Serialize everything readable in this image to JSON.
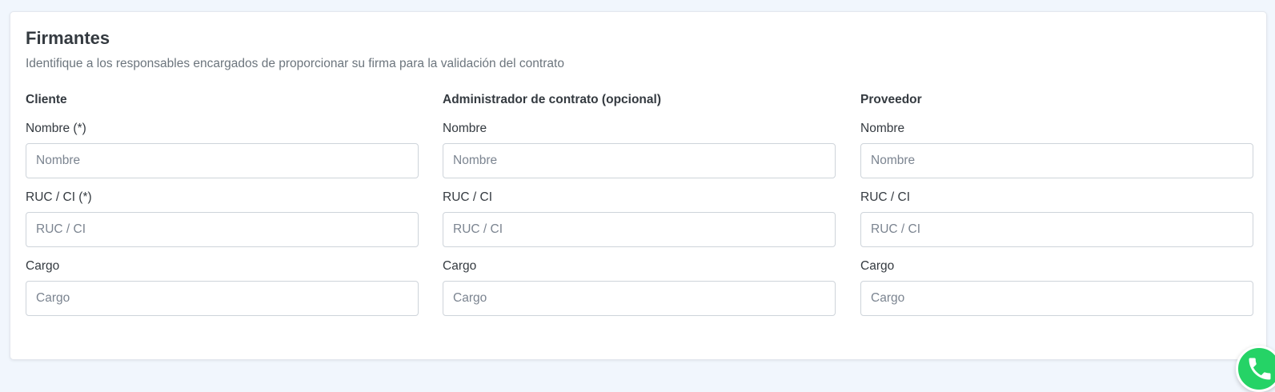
{
  "section": {
    "title": "Firmantes",
    "subtitle": "Identifique a los responsables encargados de proporcionar su firma para la validación del contrato"
  },
  "columns": [
    {
      "heading": "Cliente",
      "fields": [
        {
          "label": "Nombre (*)",
          "placeholder": "Nombre",
          "value": ""
        },
        {
          "label": "RUC / CI (*)",
          "placeholder": "RUC / CI",
          "value": ""
        },
        {
          "label": "Cargo",
          "placeholder": "Cargo",
          "value": ""
        }
      ]
    },
    {
      "heading": "Administrador de contrato (opcional)",
      "fields": [
        {
          "label": "Nombre",
          "placeholder": "Nombre",
          "value": ""
        },
        {
          "label": "RUC / CI",
          "placeholder": "RUC / CI",
          "value": ""
        },
        {
          "label": "Cargo",
          "placeholder": "Cargo",
          "value": ""
        }
      ]
    },
    {
      "heading": "Proveedor",
      "fields": [
        {
          "label": "Nombre",
          "placeholder": "Nombre",
          "value": ""
        },
        {
          "label": "RUC / CI",
          "placeholder": "RUC / CI",
          "value": ""
        },
        {
          "label": "Cargo",
          "placeholder": "Cargo",
          "value": ""
        }
      ]
    }
  ],
  "floating_action": {
    "icon": "whatsapp-icon",
    "color": "#25d366"
  }
}
